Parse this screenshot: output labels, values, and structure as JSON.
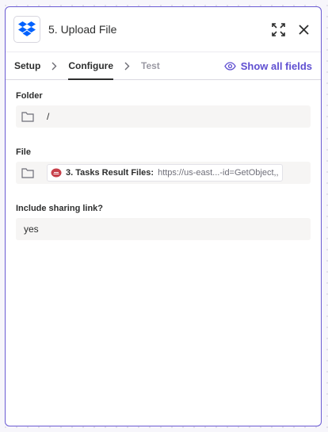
{
  "header": {
    "title": "5. Upload File",
    "app_icon": "dropbox-icon",
    "accent": "#0061fe"
  },
  "steps": {
    "setup": "Setup",
    "configure": "Configure",
    "test": "Test",
    "show_all": "Show all fields"
  },
  "fields": {
    "folder": {
      "label": "Folder",
      "value": "/"
    },
    "file": {
      "label": "File",
      "pill_label": "3. Tasks Result Files:",
      "pill_value": "https://us-east...-id=GetObject,,"
    },
    "sharing": {
      "label": "Include sharing link?",
      "value": "yes"
    }
  },
  "colors": {
    "brand": "#5f4fd1",
    "border": "#6b5bd3"
  }
}
